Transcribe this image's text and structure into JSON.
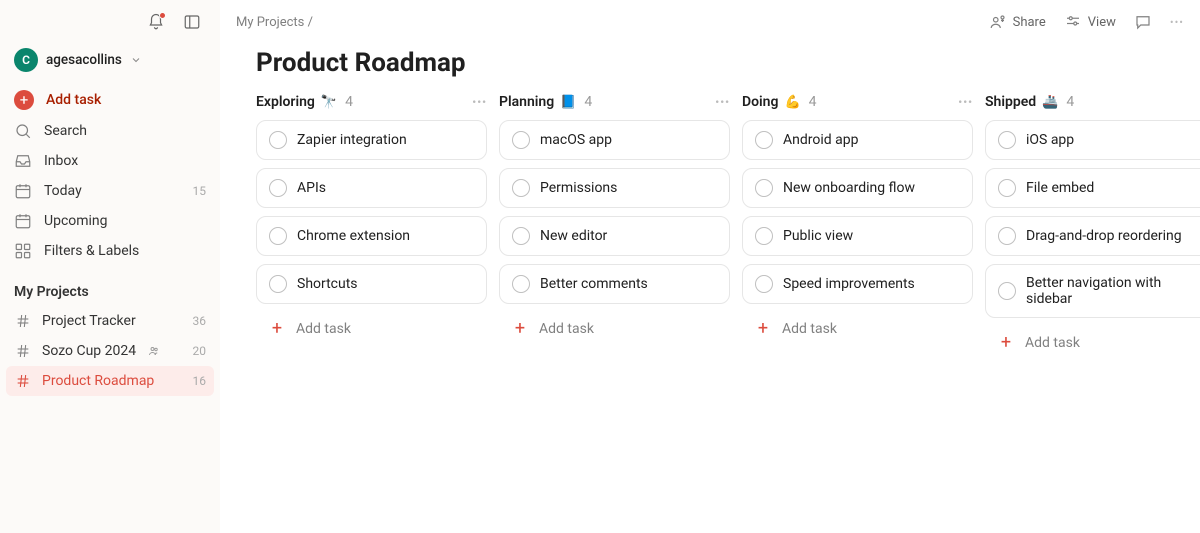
{
  "user": {
    "initial": "C",
    "name": "agesacollins"
  },
  "sidebar": {
    "add_task": "Add task",
    "nav": [
      {
        "id": "search",
        "label": "Search"
      },
      {
        "id": "inbox",
        "label": "Inbox"
      },
      {
        "id": "today",
        "label": "Today",
        "count": "15"
      },
      {
        "id": "upcoming",
        "label": "Upcoming"
      },
      {
        "id": "filters",
        "label": "Filters & Labels"
      }
    ],
    "projects_title": "My Projects",
    "projects": [
      {
        "id": "tracker",
        "label": "Project Tracker",
        "count": "36"
      },
      {
        "id": "sozo",
        "label": "Sozo Cup 2024",
        "count": "20",
        "shared": true
      },
      {
        "id": "roadmap",
        "label": "Product Roadmap",
        "count": "16",
        "active": true
      }
    ]
  },
  "topbar": {
    "breadcrumb": "My Projects /",
    "share": "Share",
    "view": "View"
  },
  "page": {
    "title": "Product Roadmap"
  },
  "board": {
    "add_task_label": "Add task",
    "columns": [
      {
        "id": "exploring",
        "title": "Exploring",
        "emoji": "🔭",
        "count": "4",
        "cards": [
          "Zapier integration",
          "APIs",
          "Chrome extension",
          "Shortcuts"
        ]
      },
      {
        "id": "planning",
        "title": "Planning",
        "emoji": "📘",
        "count": "4",
        "cards": [
          "macOS app",
          "Permissions",
          "New editor",
          "Better comments"
        ]
      },
      {
        "id": "doing",
        "title": "Doing",
        "emoji": "💪",
        "count": "4",
        "cards": [
          "Android app",
          "New onboarding flow",
          "Public view",
          "Speed improvements"
        ]
      },
      {
        "id": "shipped",
        "title": "Shipped",
        "emoji": "🚢",
        "count": "4",
        "cards": [
          "iOS app",
          "File embed",
          "Drag-and-drop reordering",
          "Better navigation with sidebar"
        ]
      }
    ]
  }
}
